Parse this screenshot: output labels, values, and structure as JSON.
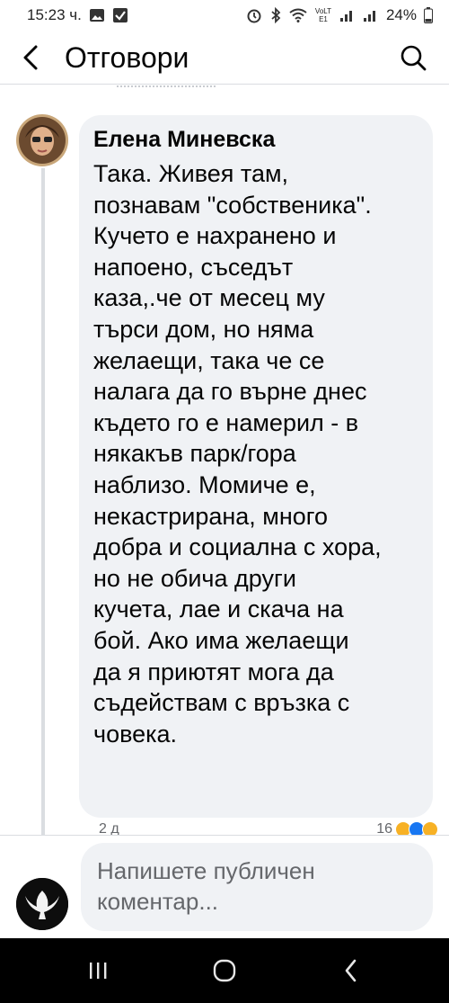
{
  "status_bar": {
    "time": "15:23 ч.",
    "battery": "24%",
    "network_label": "VoLTE1"
  },
  "header": {
    "title": "Отговори"
  },
  "comment": {
    "author": "Елена Миневска",
    "text": "Така. Живея там,\nпознавам \"собственика\".\nКучето е нахранено и\nнапоено, съседът\nказа,.че от месец му\nтърси дом, но няма\nжелаещи, така че се\nналага да го върне днес\nкъдето го е намерил - в\nнякакъв парк/гора\nнаблизо. Момиче е,\nнекастрирана, много\nдобра и социална с хора,\nно не обича други\nкучета, лае и скача на\nбой. Ако има желаещи\nда я приютят мога да\nсъдействам с връзка с\nчовека.",
    "time_ago": "2 д",
    "reaction_count": "16",
    "reaction_colors": [
      "#f7b125",
      "#1877f2",
      "#f7b125"
    ]
  },
  "composer": {
    "placeholder": "Напишете публичен коментар..."
  },
  "colors": {
    "bubble_bg": "#f0f2f5",
    "text": "#050505",
    "muted": "#65676b",
    "divider": "#dadde1"
  }
}
